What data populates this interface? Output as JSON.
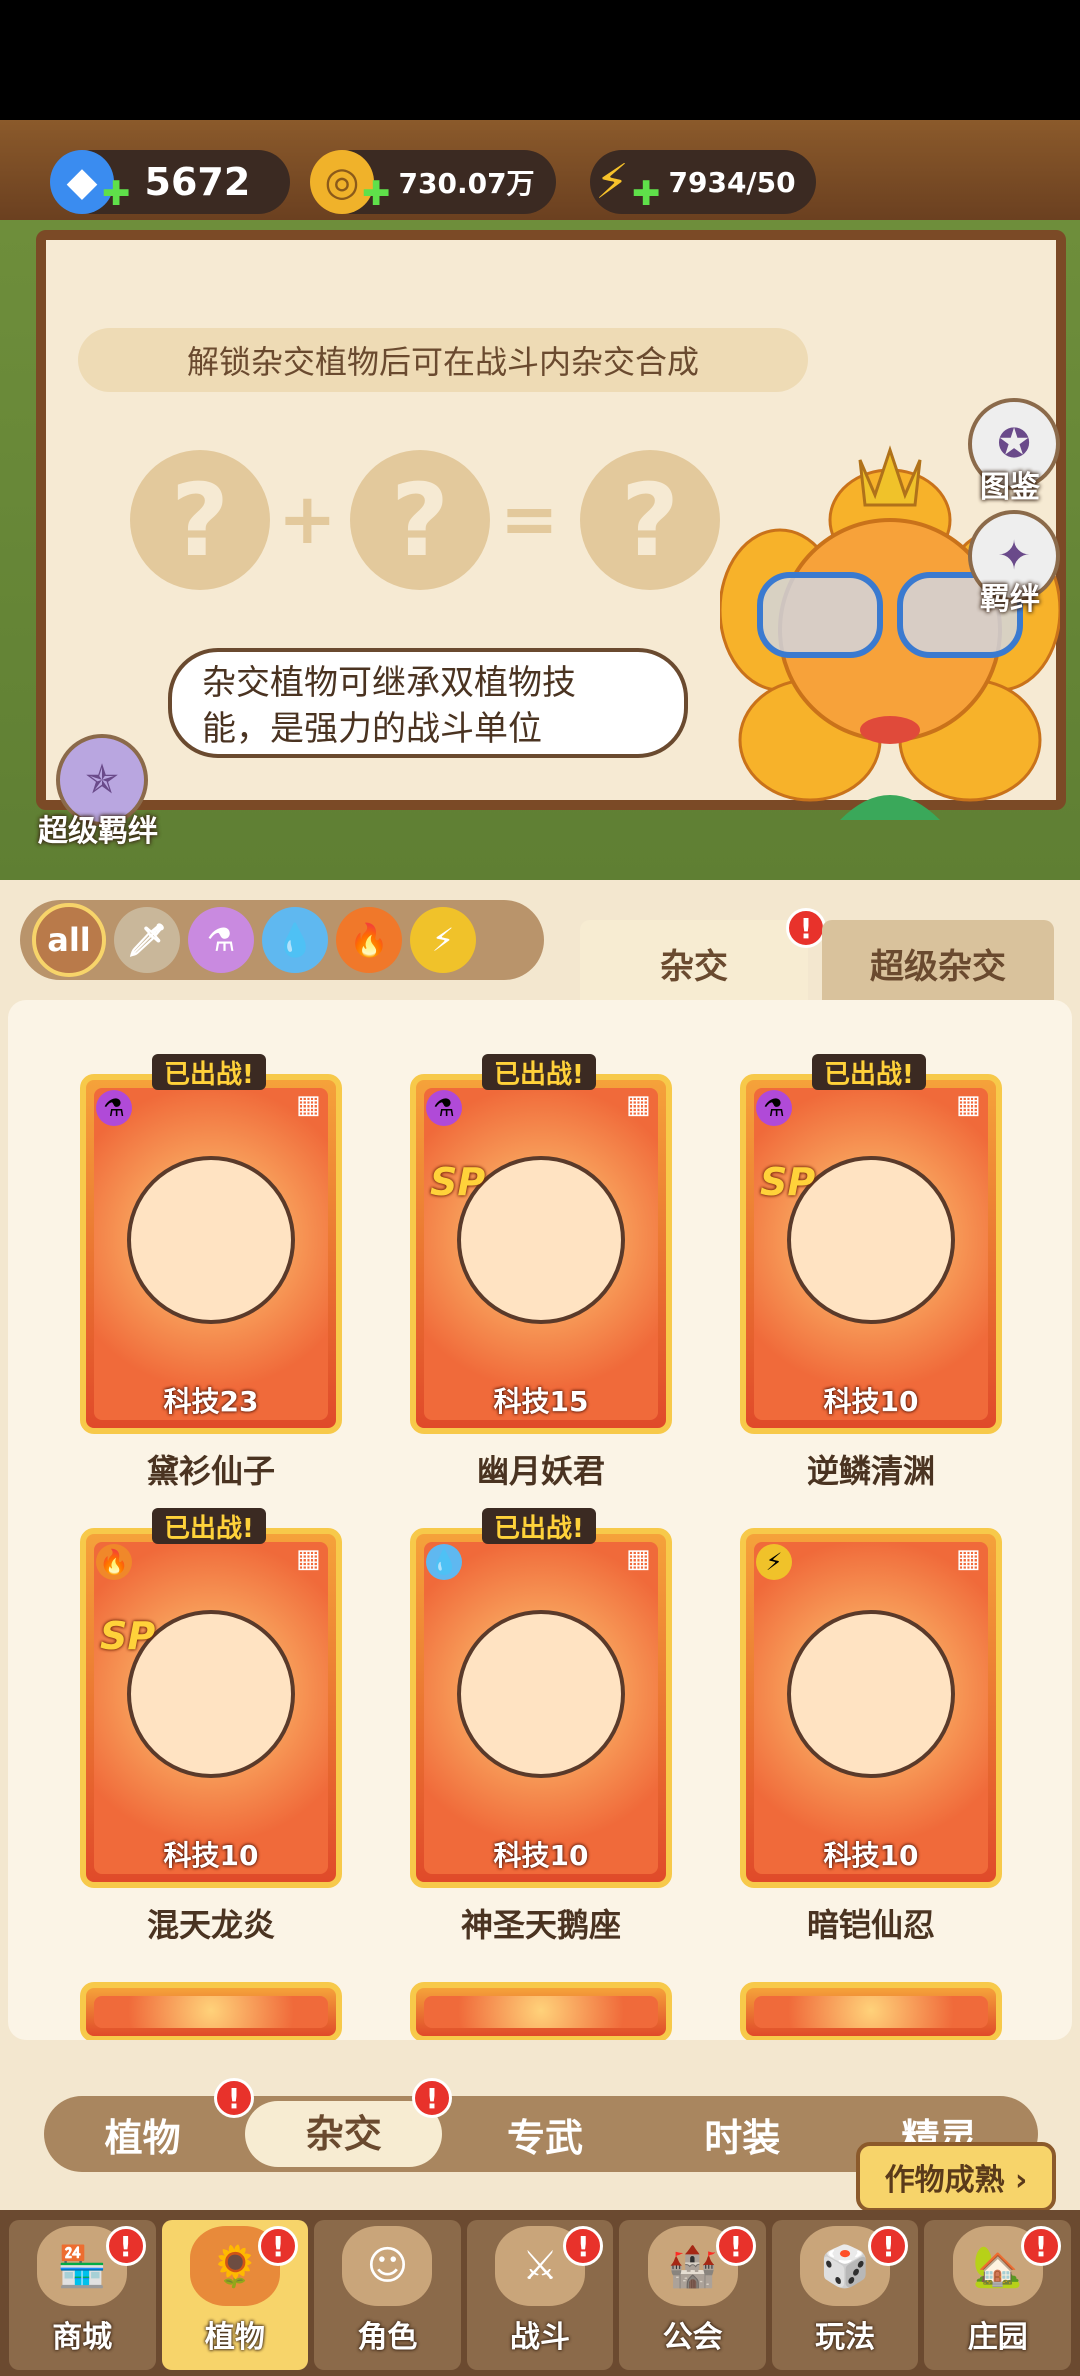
{
  "currency": {
    "gems": "5672",
    "coins": "730.07万",
    "energy": "7934/50"
  },
  "banner": {
    "tip": "解锁杂交植物后可在战斗内杂交合成",
    "bubble_line1": "杂交植物可继承双植物技",
    "bubble_line2": "能，是强力的战斗单位",
    "catalog_label": "图鉴",
    "bond_label": "羁绊",
    "super_bond_label": "超级羁绊",
    "plus_symbol": "+",
    "equals_symbol": "=",
    "question": "?"
  },
  "filters": {
    "all_label": "all"
  },
  "tabs": {
    "hybrid": "杂交",
    "super_hybrid": "超级杂交",
    "badge": "!"
  },
  "cards": [
    {
      "name": "黛衫仙子",
      "tech": "科技23",
      "deployed": "已出战!",
      "sp": "",
      "elem_color": "#b04ad8"
    },
    {
      "name": "幽月妖君",
      "tech": "科技15",
      "deployed": "已出战!",
      "sp": "SP",
      "elem_color": "#b04ad8"
    },
    {
      "name": "逆鳞清渊",
      "tech": "科技10",
      "deployed": "已出战!",
      "sp": "SP",
      "elem_color": "#b04ad8"
    },
    {
      "name": "混天龙炎",
      "tech": "科技10",
      "deployed": "已出战!",
      "sp": "SP",
      "elem_color": "#f0882a"
    },
    {
      "name": "神圣天鹅座",
      "tech": "科技10",
      "deployed": "已出战!",
      "sp": "",
      "elem_color": "#5fb8f0"
    },
    {
      "name": "暗铠仙忍",
      "tech": "科技10",
      "deployed": "",
      "sp": "",
      "elem_color": "#f0c22a"
    }
  ],
  "subtabs": [
    "植物",
    "杂交",
    "专武",
    "时装",
    "精灵"
  ],
  "harvest": "作物成熟 ›",
  "nav": [
    "商城",
    "植物",
    "角色",
    "战斗",
    "公会",
    "玩法",
    "庄园"
  ]
}
